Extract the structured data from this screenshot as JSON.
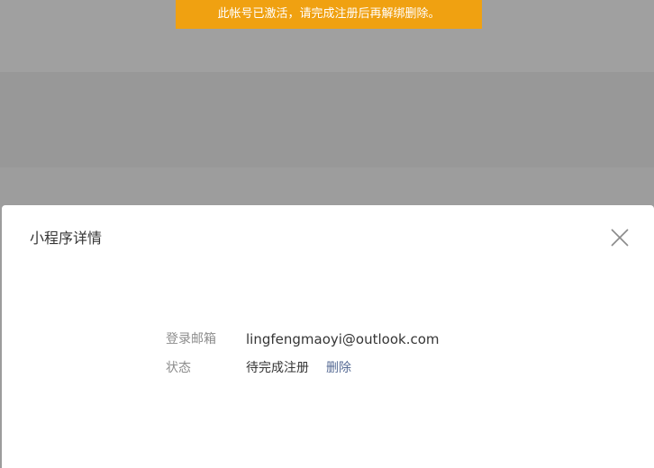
{
  "toast": {
    "message": "此帐号已激活，请完成注册后再解绑删除。"
  },
  "dialog": {
    "title": "小程序详情",
    "close_icon": "close-icon",
    "details": {
      "email_label": "登录邮箱",
      "email_value": "lingfengmaoyi@outlook.com",
      "status_label": "状态",
      "status_value": "待完成注册",
      "delete_label": "删除"
    }
  },
  "colors": {
    "toast_bg": "#f0a111",
    "link": "#576b95",
    "overlay": "#9c9c9c"
  }
}
